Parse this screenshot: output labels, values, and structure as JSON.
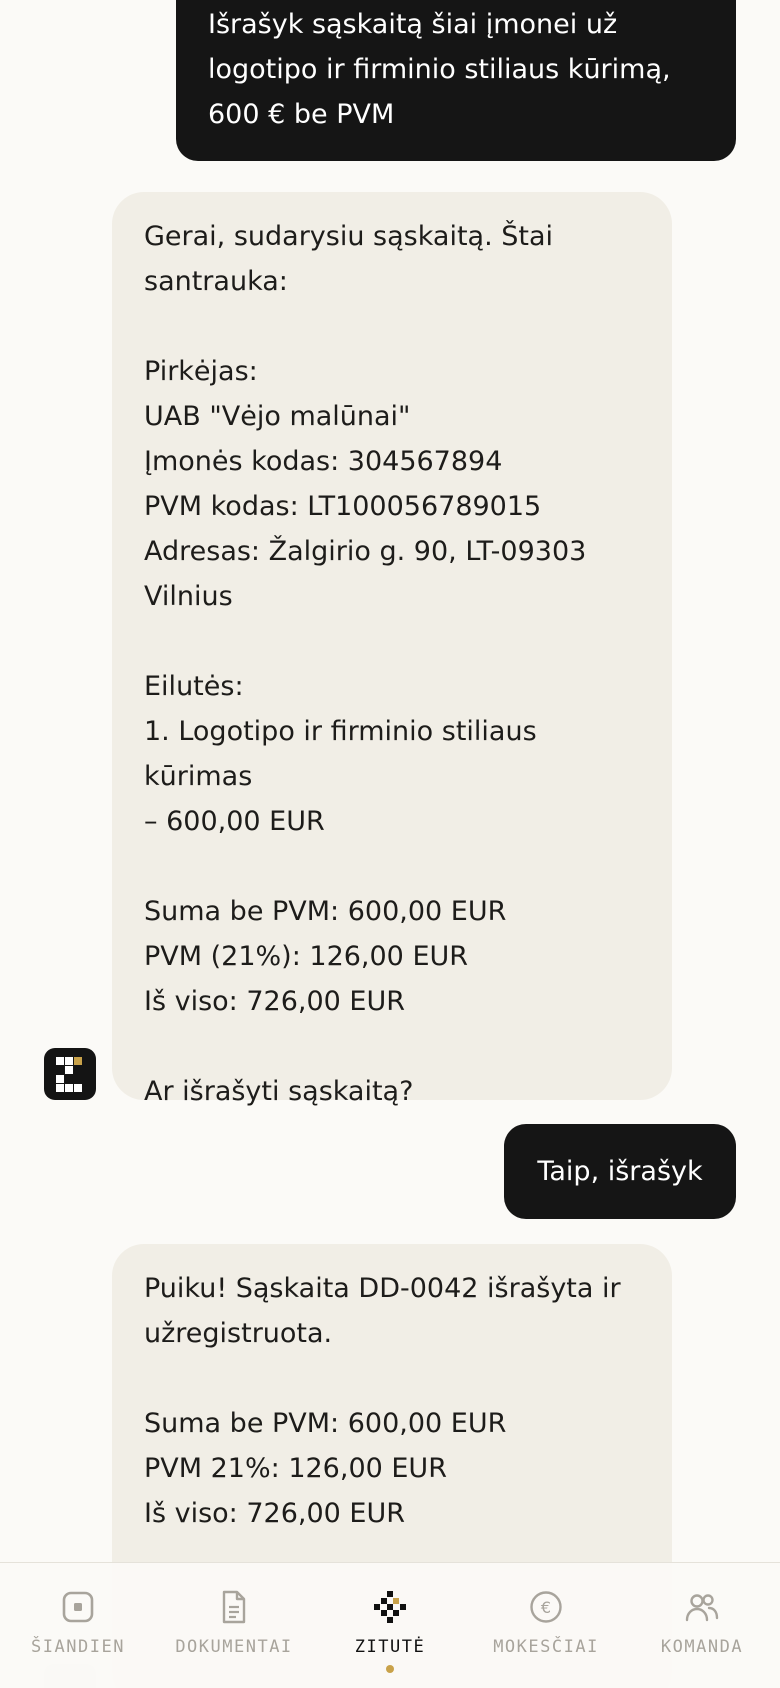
{
  "messages": {
    "user_1": "Išrašyk sąskaitą šiai įmonei už\nlogotipo ir firminio stiliaus kūrimą,\n600 € be PVM",
    "ai_1": "Gerai, sudarysiu sąskaitą. Štai\nsantrauka:\n\nPirkėjas:\nUAB \"Vėjo malūnai\"\nĮmonės kodas: 304567894\nPVM kodas: LT100056789015\nAdresas: Žalgirio g. 90, LT-09303\nVilnius\n\nEilutės:\n1. Logotipo ir firminio stiliaus kūrimas\n– 600,00 EUR\n\nSuma be PVM: 600,00 EUR\nPVM (21%): 126,00 EUR\nIš viso: 726,00 EUR\n\nAr išrašyti sąskaitą?",
    "user_2": "Taip, išrašyk",
    "ai_2": "Puiku! Sąskaita DD-0042 išrašyta ir\nužregistruota.\n\nSuma be PVM: 600,00 EUR\nPVM 21%: 126,00 EUR\nIš viso: 726,00 EUR"
  },
  "assistant": {
    "avatar_icon": "zitute-logo-icon"
  },
  "tabbar": {
    "items": [
      {
        "label": "ŠIANDIEN",
        "icon": "today-square-icon",
        "active": false
      },
      {
        "label": "DOKUMENTAI",
        "icon": "document-icon",
        "active": false
      },
      {
        "label": "ZITUTĖ",
        "icon": "zitute-sparkle-icon",
        "active": true
      },
      {
        "label": "MOKESČIAI",
        "icon": "euro-coin-icon",
        "active": false
      },
      {
        "label": "KOMANDA",
        "icon": "team-icon",
        "active": false
      }
    ]
  },
  "colors": {
    "background": "#fbfaf7",
    "user_bubble": "#151515",
    "assistant_bubble": "#f1eee6",
    "accent": "#c9a24a",
    "inactive": "#a8a49c"
  }
}
